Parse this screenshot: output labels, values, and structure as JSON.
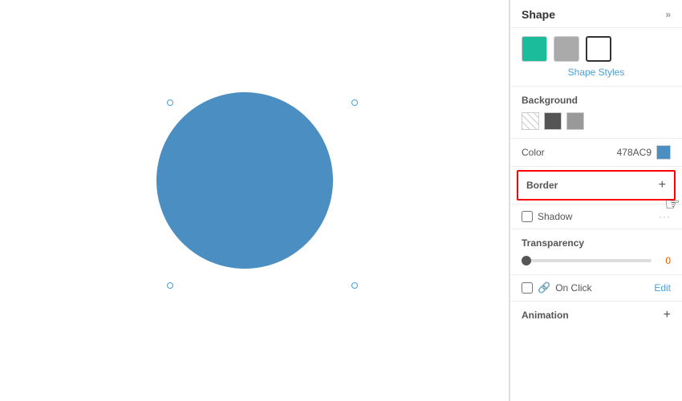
{
  "panel": {
    "title": "Shape",
    "expand_icon": "»",
    "shape_styles_label": "Shape Styles",
    "swatches": [
      {
        "color": "#1abc9c",
        "label": "teal"
      },
      {
        "color": "#aaa",
        "label": "gray"
      },
      {
        "color": "#fff",
        "label": "white-outline"
      }
    ],
    "background": {
      "label": "Background",
      "swatches": [
        {
          "color": "transparent",
          "label": "none",
          "pattern": "diagonal"
        },
        {
          "color": "#555",
          "label": "dark-gray"
        },
        {
          "color": "#999",
          "label": "medium-gray"
        }
      ]
    },
    "color": {
      "label": "Color",
      "hex": "478AC9",
      "swatch_color": "#4a8ec2"
    },
    "border": {
      "label": "Border",
      "plus_icon": "+"
    },
    "shadow": {
      "label": "Shadow",
      "dots": "..."
    },
    "transparency": {
      "label": "Transparency",
      "value": "0",
      "min": 0,
      "max": 100,
      "current": 0
    },
    "onclick": {
      "label": "On Click",
      "edit_label": "Edit",
      "link_icon": "🔗"
    },
    "animation": {
      "label": "Animation",
      "plus_icon": "+"
    }
  },
  "canvas": {
    "circle_color": "#4a8ec2"
  }
}
